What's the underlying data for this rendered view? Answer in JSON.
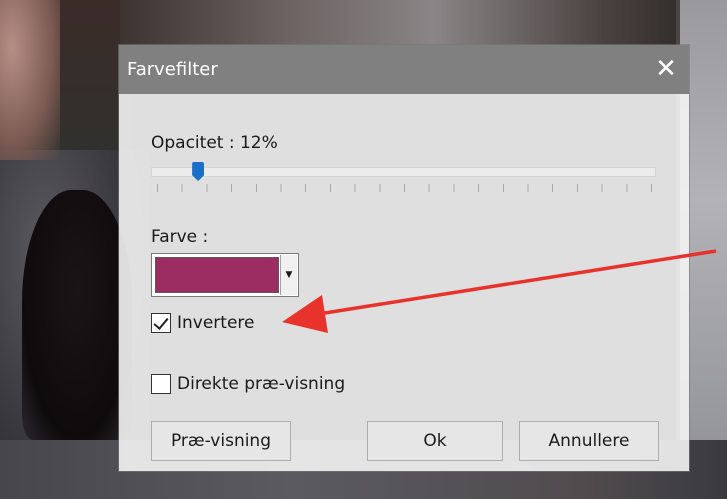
{
  "dialog": {
    "title": "Farvefilter",
    "close_symbol": "✕",
    "opacity_label": "Opacitet : 12%",
    "opacity_value_percent": 12,
    "color_label": "Farve :",
    "selected_color": "#9b2d63",
    "combo_arrow_symbol": "▼",
    "invert_label": "Invertere",
    "invert_checked": true,
    "direct_preview_label": "Direkte præ-visning",
    "direct_preview_checked": false,
    "preview_button_label": "Præ-visning",
    "ok_button_label": "Ok",
    "cancel_button_label": "Annullere"
  },
  "annotation": {
    "arrow_color": "#e8322c"
  },
  "theme": {
    "titlebar_color": "#808080",
    "slider_thumb_color": "#1a6fc9"
  }
}
